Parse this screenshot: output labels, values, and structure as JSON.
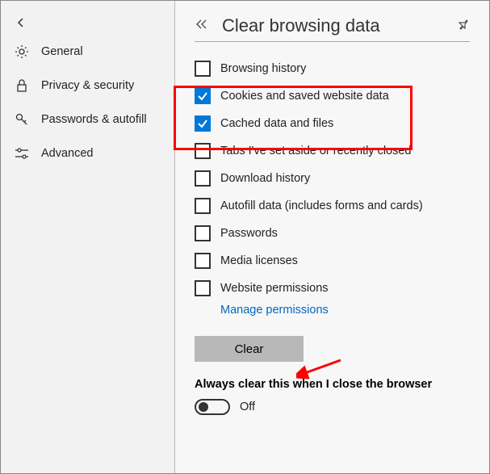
{
  "sidebar": {
    "items": [
      {
        "icon": "gear",
        "label": "General"
      },
      {
        "icon": "lock",
        "label": "Privacy & security"
      },
      {
        "icon": "key",
        "label": "Passwords & autofill"
      },
      {
        "icon": "sliders",
        "label": "Advanced"
      }
    ]
  },
  "header": {
    "title": "Clear browsing data"
  },
  "checklist": [
    {
      "label": "Browsing history",
      "checked": false
    },
    {
      "label": "Cookies and saved website data",
      "checked": true
    },
    {
      "label": "Cached data and files",
      "checked": true
    },
    {
      "label": "Tabs I've set aside or recently closed",
      "checked": false
    },
    {
      "label": "Download history",
      "checked": false
    },
    {
      "label": "Autofill data (includes forms and cards)",
      "checked": false
    },
    {
      "label": "Passwords",
      "checked": false
    },
    {
      "label": "Media licenses",
      "checked": false
    },
    {
      "label": "Website permissions",
      "checked": false
    }
  ],
  "manage_link": "Manage permissions",
  "clear_button": "Clear",
  "always_clear": {
    "label": "Always clear this when I close the browser",
    "state": "Off"
  }
}
